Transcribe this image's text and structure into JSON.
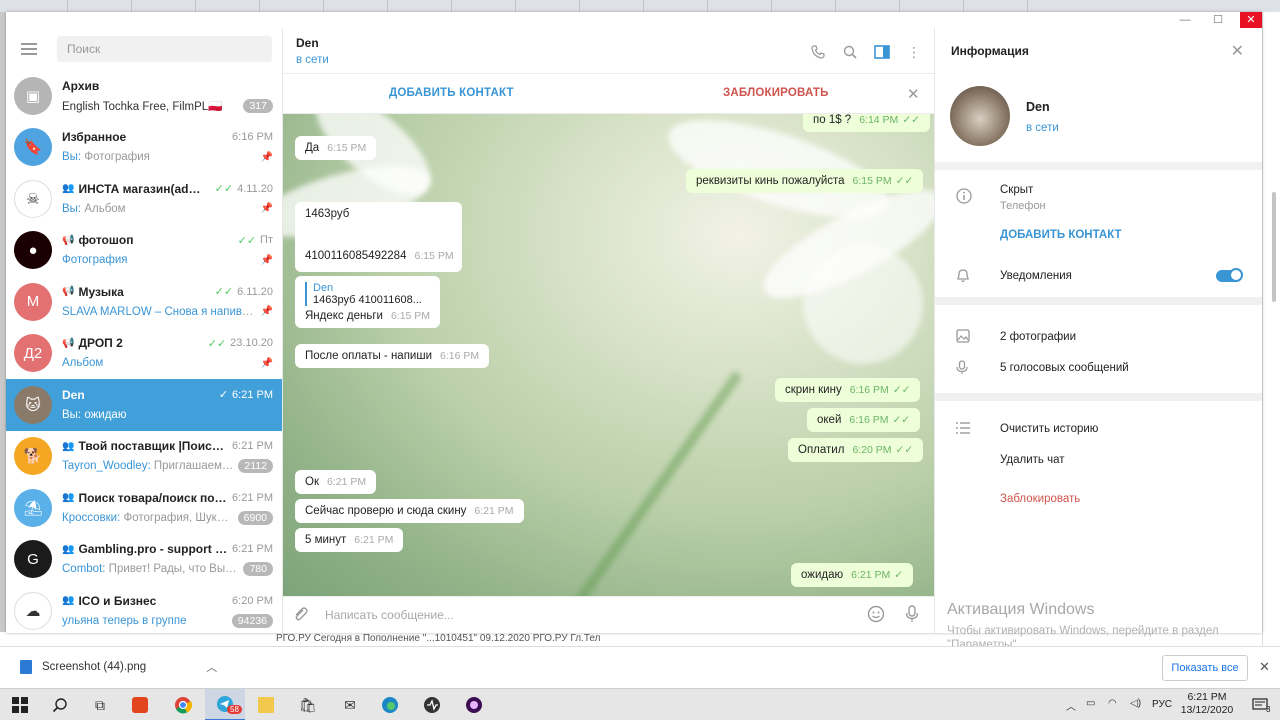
{
  "sidebar": {
    "search_placeholder": "Поиск",
    "chats": [
      {
        "name": "Архив",
        "preview_accent": "",
        "preview_sender": "",
        "preview_rest": "English Tochka Free, FilmPL🇵🇱",
        "time": "",
        "badge": "317",
        "check": "",
        "icon": "",
        "pinned": false,
        "avatar_color": "#b5b5b5",
        "avatar_text": "▣"
      },
      {
        "name": "Избранное",
        "preview_accent": "Вы: ",
        "preview_sender": "",
        "preview_rest": "Фотография",
        "time": "6:16 PM",
        "badge": "",
        "check": "",
        "icon": "",
        "pinned": true,
        "avatar_color": "#4fa3e0",
        "avatar_text": "🔖"
      },
      {
        "name": "ИНСТА магазин(admin)",
        "preview_accent": "Вы: ",
        "preview_sender": "",
        "preview_rest": "Альбом",
        "time": "4.11.20",
        "badge": "",
        "check": "✓✓",
        "icon": "group",
        "pinned": true,
        "avatar_color": "#ffffff",
        "avatar_text": "☠"
      },
      {
        "name": "фотошоп",
        "preview_accent": "Фотография",
        "preview_sender": "",
        "preview_rest": "",
        "time": "Пт",
        "badge": "",
        "check": "✓✓",
        "icon": "mega",
        "pinned": true,
        "avatar_color": "#1a0000",
        "avatar_text": "●"
      },
      {
        "name": "Музыка",
        "preview_accent": "SLAVA MARLOW – Снова я напиваю...",
        "preview_sender": "",
        "preview_rest": "",
        "time": "6.11.20",
        "badge": "",
        "check": "✓✓",
        "icon": "mega",
        "pinned": true,
        "avatar_color": "#e37171",
        "avatar_text": "М"
      },
      {
        "name": "ДРОП 2",
        "preview_accent": "Альбом",
        "preview_sender": "",
        "preview_rest": "",
        "time": "23.10.20",
        "badge": "",
        "check": "✓✓",
        "icon": "mega",
        "pinned": true,
        "avatar_color": "#e37171",
        "avatar_text": "Д2"
      },
      {
        "name": "Den",
        "preview_accent": "Вы: ожидаю",
        "preview_sender": "",
        "preview_rest": "",
        "time": "6:21 PM",
        "badge": "",
        "check": "✓",
        "icon": "",
        "pinned": false,
        "avatar_color": "#8a7a6a",
        "avatar_text": "🐱",
        "active": true
      },
      {
        "name": "Твой поставщик |Поиск т...",
        "preview_accent": "",
        "preview_sender": "Tayron_Woodley: ",
        "preview_rest": "Приглашаем к ...",
        "time": "6:21 PM",
        "badge": "2112",
        "check": "",
        "icon": "group",
        "pinned": false,
        "avatar_color": "#f5a623",
        "avatar_text": "🐕"
      },
      {
        "name": "Поиск товара/поиск поста...",
        "preview_accent": "",
        "preview_sender": "Кроссовки: ",
        "preview_rest": "Фотография, Шукаю...",
        "time": "6:21 PM",
        "badge": "6900",
        "check": "",
        "icon": "group",
        "pinned": false,
        "avatar_color": "#5ab0e8",
        "avatar_text": "⛱"
      },
      {
        "name": "Gambling.pro - support (он...",
        "preview_accent": "",
        "preview_sender": "Combot: ",
        "preview_rest": "Привет! Рады, что Вы с ...",
        "time": "6:21 PM",
        "badge": "780",
        "check": "",
        "icon": "group",
        "pinned": false,
        "avatar_color": "#1b1b1b",
        "avatar_text": "G"
      },
      {
        "name": "ICO и Бизнес",
        "preview_accent": "ульяна теперь в группе",
        "preview_sender": "",
        "preview_rest": "",
        "time": "6:20 PM",
        "badge": "94236",
        "check": "",
        "icon": "group",
        "pinned": false,
        "avatar_color": "#ffffff",
        "avatar_text": "☁"
      }
    ]
  },
  "chat": {
    "name": "Den",
    "status": "в сети",
    "add_contact": "ДОБАВИТЬ КОНТАКТ",
    "block": "ЗАБЛОКИРОВАТЬ",
    "composer_placeholder": "Написать сообщение...",
    "messages": {
      "m0": {
        "text": "по 1$ ?",
        "time": "6:14 PM"
      },
      "m1": {
        "text": "Да",
        "time": "6:15 PM"
      },
      "m2": {
        "text": "реквизиты кинь пожалуйста",
        "time": "6:15 PM"
      },
      "m3": {
        "line1": "1463руб",
        "line2": "4100116085492284",
        "time": "6:15 PM"
      },
      "m4": {
        "reply_name": "Den",
        "reply_text": "1463руб    410011608...",
        "text": "Яндекс деньги",
        "time": "6:15 PM"
      },
      "m5": {
        "text": "После оплаты - напиши",
        "time": "6:16 PM"
      },
      "m6": {
        "text": "скрин кину",
        "time": "6:16 PM"
      },
      "m7": {
        "text": "окей",
        "time": "6:16 PM"
      },
      "m8": {
        "text": "Оплатил",
        "time": "6:20 PM"
      },
      "m9": {
        "text": "Ок",
        "time": "6:21 PM"
      },
      "m10": {
        "text": "Сейчас проверю и сюда скину",
        "time": "6:21 PM"
      },
      "m11": {
        "text": "5 минут",
        "time": "6:21 PM"
      },
      "m12": {
        "text": "ожидаю",
        "time": "6:21 PM"
      }
    }
  },
  "info": {
    "title": "Информация",
    "name": "Den",
    "status": "в сети",
    "phone_value": "Скрыт",
    "phone_label": "Телефон",
    "add_contact": "ДОБАВИТЬ КОНТАКТ",
    "notifications": "Уведомления",
    "photos": "2 фотографии",
    "voice": "5 голосовых сообщений",
    "clear_history": "Очистить историю",
    "delete_chat": "Удалить чат",
    "block": "Заблокировать"
  },
  "activation": {
    "title": "Активация Windows",
    "line1": "Чтобы активировать Windows, перейдите в раздел",
    "line2": "\"Параметры\"."
  },
  "browser_strip": "РГО.РУ                                  Сегодня в                    Пополнение                                    \"...1010451\"                              09.12.2020 РГО.РУ Гл.Тел",
  "download": {
    "file": "Screenshot (44).png",
    "show_all": "Показать все"
  },
  "taskbar": {
    "lang": "РУС",
    "time": "6:21 PM",
    "date": "13/12/2020",
    "telegram_badge": "58",
    "notif_count": "3"
  },
  "colors": {
    "accent": "#419fd9",
    "link": "#3a95d5",
    "danger": "#d0544d",
    "out_bubble": "#eefed9",
    "check": "#4dcd5e"
  }
}
